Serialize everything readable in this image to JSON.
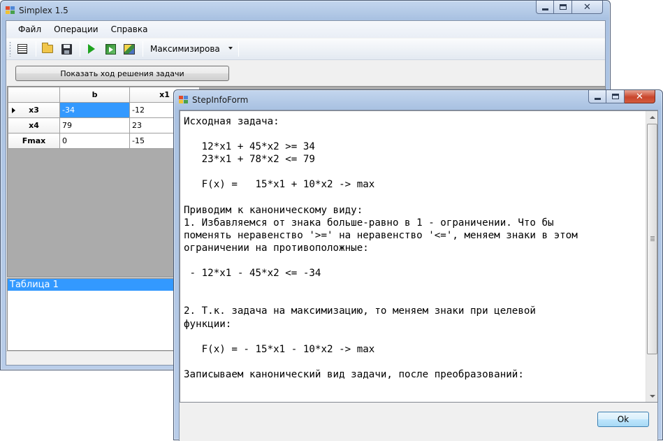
{
  "main_window": {
    "title": "Simplex 1.5",
    "menu": [
      "Файл",
      "Операции",
      "Справка"
    ],
    "toolbar": {
      "icons": [
        "new-table-icon",
        "open-folder-icon",
        "save-icon",
        "run-icon",
        "step-icon",
        "image-icon"
      ],
      "mode_select_value": "Максимизировать"
    },
    "show_steps_button": "Показать ход решения задачи",
    "grid": {
      "columns": [
        "",
        "b",
        "x1"
      ],
      "rows": [
        {
          "header": "x3",
          "cells": [
            "-34",
            "-12"
          ]
        },
        {
          "header": "x4",
          "cells": [
            "79",
            "23"
          ]
        },
        {
          "header": "Fmax",
          "cells": [
            "0",
            "-15"
          ]
        }
      ]
    },
    "list": {
      "items": [
        "Таблица 1"
      ]
    }
  },
  "step_window": {
    "title": "StepInfoForm",
    "text": "Исходная задача:\n\n   12*x1 + 45*x2 >= 34\n   23*x1 + 78*x2 <= 79\n\n   F(x) =   15*x1 + 10*x2 -> max\n\nПриводим к каноническому виду:\n1. Избавляемся от знака больше-равно в 1 - ограничении. Что бы\nпоменять неравенство '>=' на неравенство '<=', меняем знаки в этом\nограничении на противоположные:\n\n - 12*x1 - 45*x2 <= -34\n\n\n2. Т.к. задача на максимизацию, то меняем знаки при целевой\nфункции:\n\n   F(x) = - 15*x1 - 10*x2 -> max\n\nЗаписываем канонический вид задачи, после преобразований:",
    "ok_button": "Ok"
  }
}
